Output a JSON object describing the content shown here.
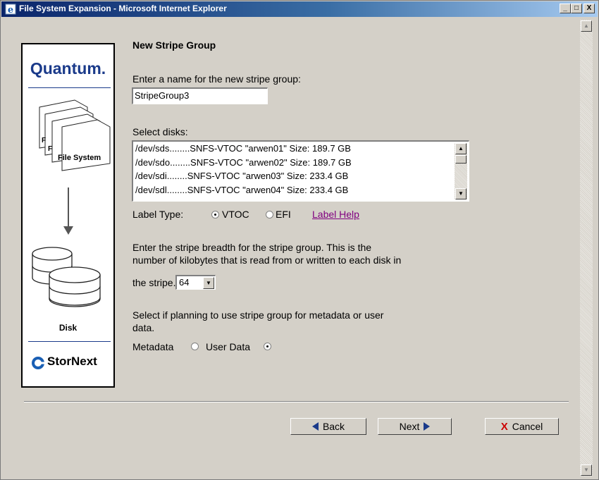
{
  "window": {
    "title": "File System Expansion - Microsoft Internet Explorer",
    "min": "_",
    "max": "□",
    "close": "X"
  },
  "sidebar": {
    "brand": "Quantum.",
    "fs_label": "File System",
    "disk_label": "Disk",
    "product": "StorNext"
  },
  "form": {
    "heading": "New Stripe Group",
    "name_prompt": "Enter a name for the new stripe group:",
    "name_value": "StripeGroup3",
    "disks_prompt": "Select disks:",
    "disks": [
      "/dev/sds........SNFS-VTOC \"arwen01\" Size: 189.7 GB",
      "/dev/sdo........SNFS-VTOC \"arwen02\" Size: 189.7 GB",
      "/dev/sdi........SNFS-VTOC \"arwen03\" Size: 233.4 GB",
      "/dev/sdl........SNFS-VTOC \"arwen04\" Size: 233.4 GB"
    ],
    "label_type_label": "Label Type:",
    "label_vtoc": "VTOC",
    "label_efi": "EFI",
    "label_help": "Label Help",
    "breadth_line1": "Enter the stripe breadth for the stripe group. This is the",
    "breadth_line2": "number of kilobytes that is read from or written to each disk in",
    "breadth_line3": "the stripe.",
    "breadth_value": "64",
    "usage_line1": "Select if planning to use stripe group for metadata or user",
    "usage_line2": "data.",
    "metadata_label": "Metadata",
    "userdata_label": "User Data"
  },
  "buttons": {
    "back": "Back",
    "next": "Next",
    "cancel": "Cancel"
  }
}
